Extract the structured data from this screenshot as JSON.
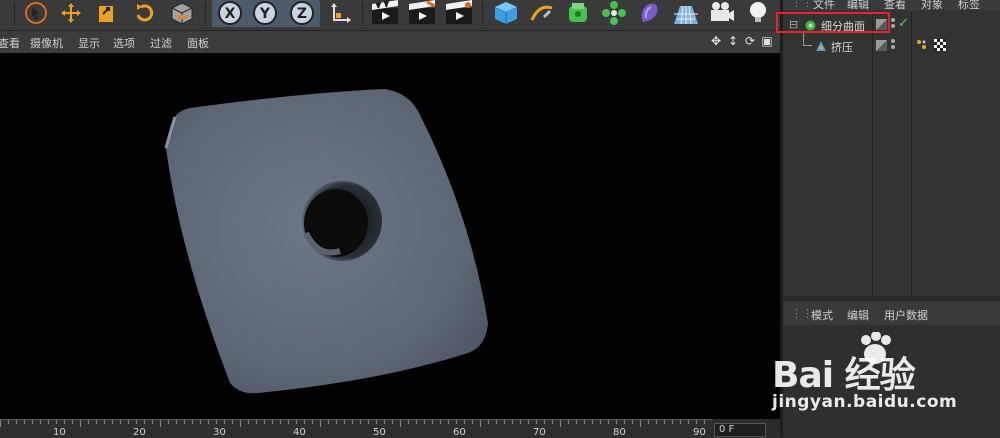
{
  "viewport_menu": [
    "查看",
    "摄像机",
    "显示",
    "选项",
    "过滤",
    "面板"
  ],
  "timeline": {
    "ticks": [
      "10",
      "20",
      "30",
      "40",
      "50",
      "60",
      "70",
      "80",
      "90"
    ],
    "frame_field": "0 F"
  },
  "object_manager": {
    "menu": [
      "文件",
      "编辑",
      "查看",
      "对象",
      "标签"
    ],
    "objects": [
      {
        "name": "细分曲面",
        "icon": "subdivision-surface-icon",
        "checked": true
      },
      {
        "name": "挤压",
        "icon": "extrude-icon",
        "checked": false
      }
    ]
  },
  "attribute_manager": {
    "menu": [
      "模式",
      "编辑",
      "用户数据"
    ]
  },
  "watermark": {
    "brand": "Bai 经验",
    "url": "jingyan.baidu.com"
  },
  "colors": {
    "highlight_box": "#e0262c",
    "viewport_bg": "#000000",
    "axis_group": "#4c5a6a"
  }
}
